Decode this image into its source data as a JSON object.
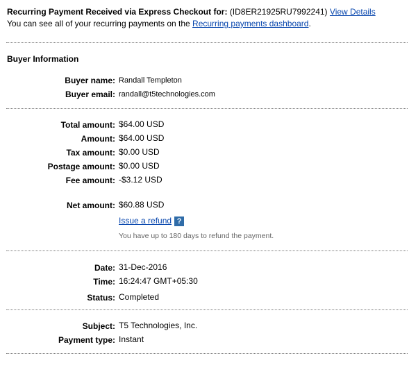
{
  "header": {
    "title_prefix": "Recurring Payment Received via Express Checkout for: ",
    "payment_id": "(ID8ER21925RU7992241)",
    "view_details_link": "View Details",
    "subtitle_prefix": "You can see all of your recurring payments on the ",
    "dashboard_link": "Recurring payments dashboard",
    "subtitle_suffix": "."
  },
  "buyer": {
    "section_title": "Buyer Information",
    "name_label": "Buyer name:",
    "name_value": "Randall Templeton",
    "email_label": "Buyer email:",
    "email_value": "randall@t5technologies.com"
  },
  "amounts": {
    "total_label": "Total amount:",
    "total_value": "$64.00 USD",
    "amount_label": "Amount:",
    "amount_value": "$64.00 USD",
    "tax_label": "Tax amount:",
    "tax_value": "$0.00 USD",
    "postage_label": "Postage amount:",
    "postage_value": "$0.00 USD",
    "fee_label": "Fee amount:",
    "fee_value": "-$3.12 USD",
    "net_label": "Net amount:",
    "net_value": "$60.88 USD",
    "refund_link": "Issue a refund",
    "help_icon_glyph": "?",
    "refund_note": "You have up to 180 days to refund the payment."
  },
  "details": {
    "date_label": "Date:",
    "date_value": "31-Dec-2016",
    "time_label": "Time:",
    "time_value": "16:24:47 GMT+05:30",
    "status_label": "Status:",
    "status_value": "Completed"
  },
  "subject_info": {
    "subject_label": "Subject:",
    "subject_value": "T5 Technologies, Inc.",
    "payment_type_label": "Payment type:",
    "payment_type_value": "Instant"
  },
  "colors": {
    "link": "#0645ad",
    "help_icon": "#2f6ca8",
    "separator": "#777777"
  }
}
